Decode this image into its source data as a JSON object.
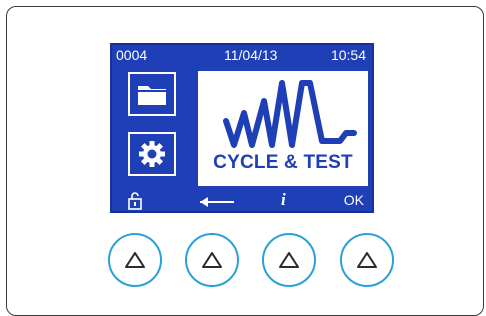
{
  "status": {
    "counter": "0004",
    "date": "11/04/13",
    "time": "10:54"
  },
  "display": {
    "title": "CYCLE & TEST"
  },
  "softkeys": {
    "info": "i",
    "ok": "OK"
  },
  "icons": [
    "folder-icon",
    "gear-icon",
    "waveform-icon",
    "lock-icon",
    "back-arrow-icon",
    "up-triangle-icon"
  ],
  "colors": {
    "lcd_blue": "#1f3fb6",
    "button_ring": "#2aa0d8"
  }
}
